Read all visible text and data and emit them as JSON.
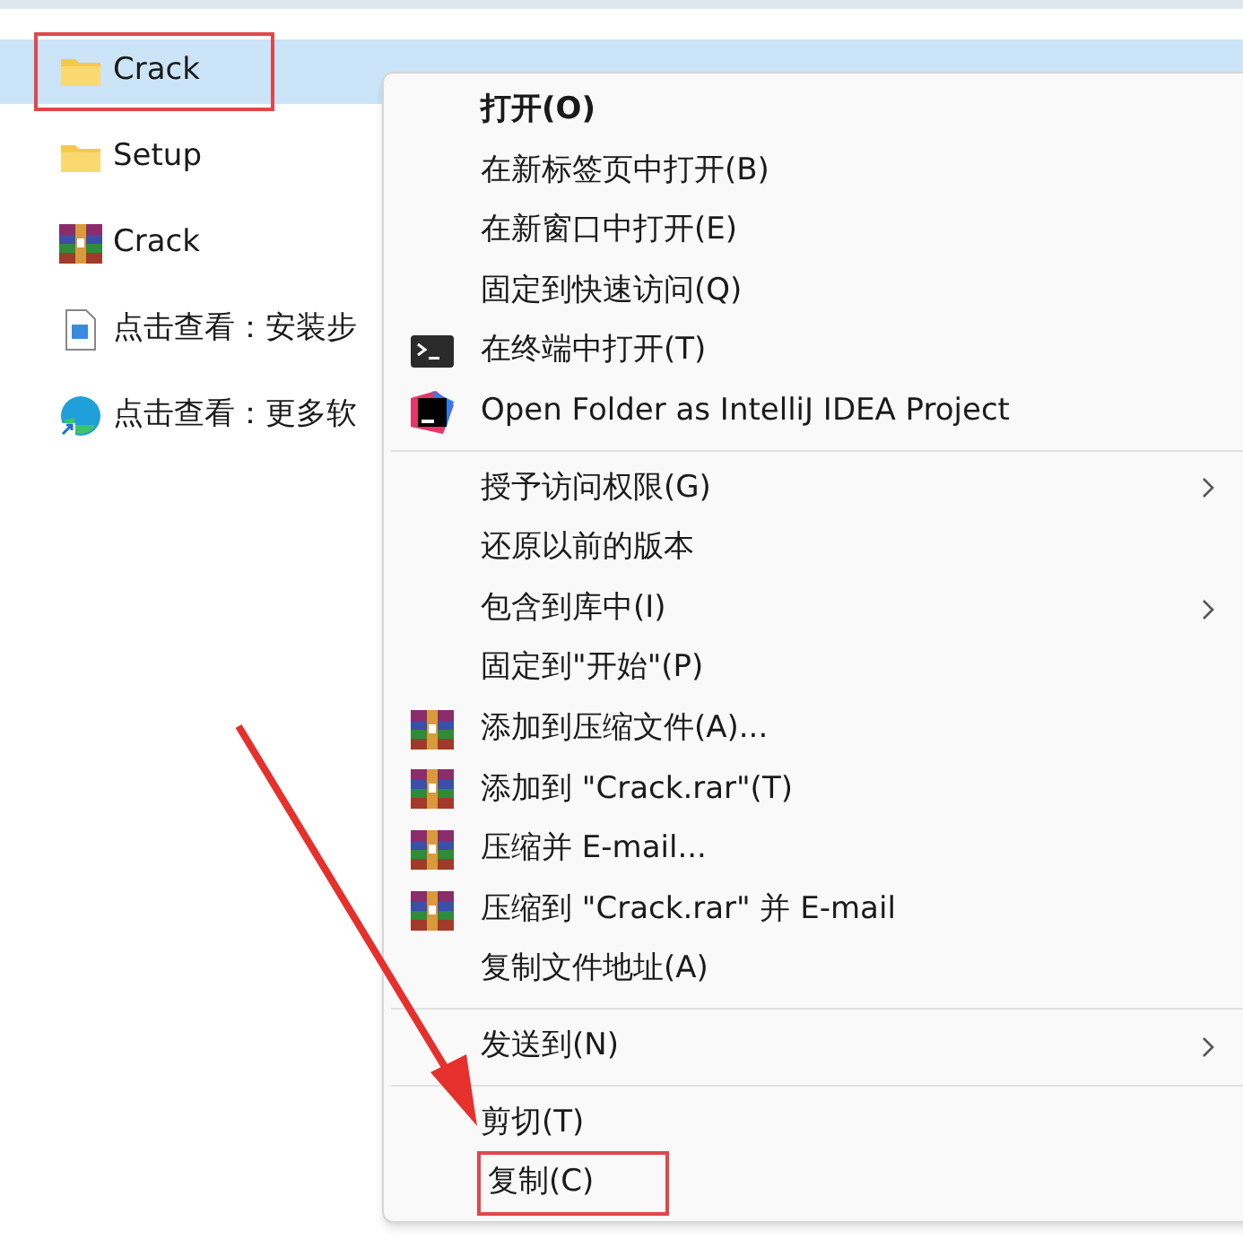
{
  "files": [
    {
      "name": "Crack",
      "kind": "folder",
      "selected": true,
      "boxed": true
    },
    {
      "name": "Setup",
      "kind": "folder",
      "selected": false,
      "boxed": false
    },
    {
      "name": "Crack",
      "kind": "archive",
      "selected": false,
      "boxed": false
    },
    {
      "name": "点击查看：安装步",
      "kind": "document",
      "selected": false,
      "boxed": false
    },
    {
      "name": "点击查看：更多软",
      "kind": "browser",
      "selected": false,
      "boxed": false
    }
  ],
  "context_menu": {
    "groups": [
      [
        {
          "label": "打开(O)",
          "kind": "plain",
          "default": true,
          "submenu": false,
          "boxed": false
        },
        {
          "label": "在新标签页中打开(B)",
          "kind": "plain",
          "default": false,
          "submenu": false,
          "boxed": false
        },
        {
          "label": "在新窗口中打开(E)",
          "kind": "plain",
          "default": false,
          "submenu": false,
          "boxed": false
        },
        {
          "label": "固定到快速访问(Q)",
          "kind": "plain",
          "default": false,
          "submenu": false,
          "boxed": false
        },
        {
          "label": "在终端中打开(T)",
          "kind": "terminal",
          "default": false,
          "submenu": false,
          "boxed": false
        },
        {
          "label": "Open Folder as IntelliJ IDEA Project",
          "kind": "ide",
          "default": false,
          "submenu": false,
          "boxed": false
        }
      ],
      [
        {
          "label": "授予访问权限(G)",
          "kind": "plain",
          "default": false,
          "submenu": true,
          "boxed": false
        },
        {
          "label": "还原以前的版本",
          "kind": "plain",
          "default": false,
          "submenu": false,
          "boxed": false
        },
        {
          "label": "包含到库中(I)",
          "kind": "plain",
          "default": false,
          "submenu": true,
          "boxed": false
        },
        {
          "label": "固定到\"开始\"(P)",
          "kind": "plain",
          "default": false,
          "submenu": false,
          "boxed": false
        },
        {
          "label": "添加到压缩文件(A)...",
          "kind": "archive",
          "default": false,
          "submenu": false,
          "boxed": false
        },
        {
          "label": "添加到 \"Crack.rar\"(T)",
          "kind": "archive",
          "default": false,
          "submenu": false,
          "boxed": false
        },
        {
          "label": "压缩并 E-mail...",
          "kind": "archive",
          "default": false,
          "submenu": false,
          "boxed": false
        },
        {
          "label": "压缩到 \"Crack.rar\" 并 E-mail",
          "kind": "archive",
          "default": false,
          "submenu": false,
          "boxed": false
        },
        {
          "label": "复制文件地址(A)",
          "kind": "plain",
          "default": false,
          "submenu": false,
          "boxed": false
        }
      ],
      [
        {
          "label": "发送到(N)",
          "kind": "plain",
          "default": false,
          "submenu": true,
          "boxed": false
        }
      ],
      [
        {
          "label": "剪切(T)",
          "kind": "plain",
          "default": false,
          "submenu": false,
          "boxed": false
        },
        {
          "label": "复制(C)",
          "kind": "plain",
          "default": false,
          "submenu": false,
          "boxed": true
        }
      ]
    ]
  }
}
